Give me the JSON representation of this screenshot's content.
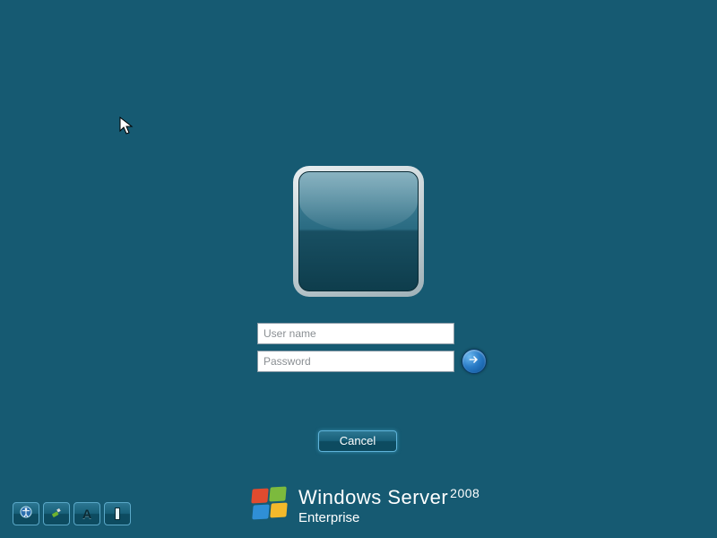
{
  "login": {
    "username_placeholder": "User name",
    "password_placeholder": "Password",
    "username_value": "",
    "password_value": ""
  },
  "buttons": {
    "cancel": "Cancel"
  },
  "branding": {
    "product_prefix": "Windows",
    "product_name": "Server",
    "year": "2008",
    "edition": "Enterprise"
  },
  "toolbar": {
    "ease_of_access": "ease-of-access",
    "usb_key": "usb-key",
    "high_contrast": "high-contrast",
    "on_screen_keyboard": "on-screen-keyboard"
  }
}
